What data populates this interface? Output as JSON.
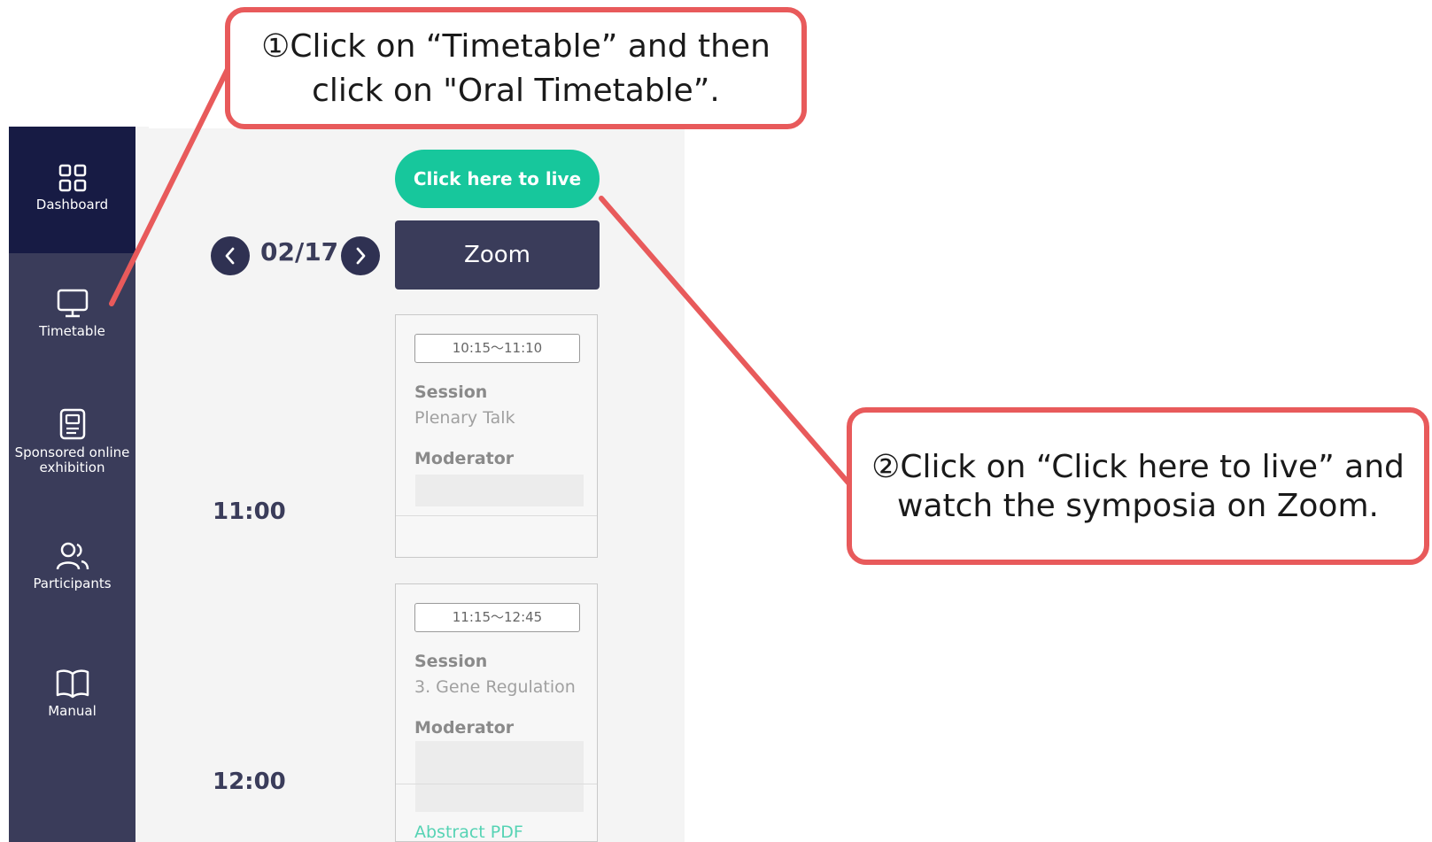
{
  "sidebar": {
    "items": [
      {
        "label": "Dashboard",
        "icon": "grid-icon",
        "active": true
      },
      {
        "label": "Timetable",
        "icon": "monitor-icon",
        "active": false
      },
      {
        "label": "Sponsored online exhibition",
        "icon": "document-icon",
        "active": false
      },
      {
        "label": "Participants",
        "icon": "people-icon",
        "active": false
      },
      {
        "label": "Manual",
        "icon": "book-icon",
        "active": false
      }
    ]
  },
  "main": {
    "live_button": "Click here to live",
    "zoom_button": "Zoom",
    "date": "02/17",
    "time_labels": [
      "11:00",
      "12:00"
    ],
    "sessions": [
      {
        "time": "10:15～11:10",
        "session_label": "Session",
        "session_name": "Plenary Talk",
        "moderator_label": "Moderator"
      },
      {
        "time": "11:15～12:45",
        "session_label": "Session",
        "session_name": "3. Gene Regulation",
        "moderator_label": "Moderator",
        "link": "Abstract PDF"
      }
    ]
  },
  "callouts": {
    "step1_line1": "①Click on “Timetable” and then",
    "step1_line2": "click on \"Oral Timetable”.",
    "step2_line1": "②Click on “Click here to live” and",
    "step2_line2": "watch the symposia on Zoom."
  },
  "colors": {
    "sidebar": "#3a3c5a",
    "sidebar_active": "#171b44",
    "live_button": "#17c79c",
    "callout_border": "#e85a5b",
    "link": "#56d3b4"
  }
}
